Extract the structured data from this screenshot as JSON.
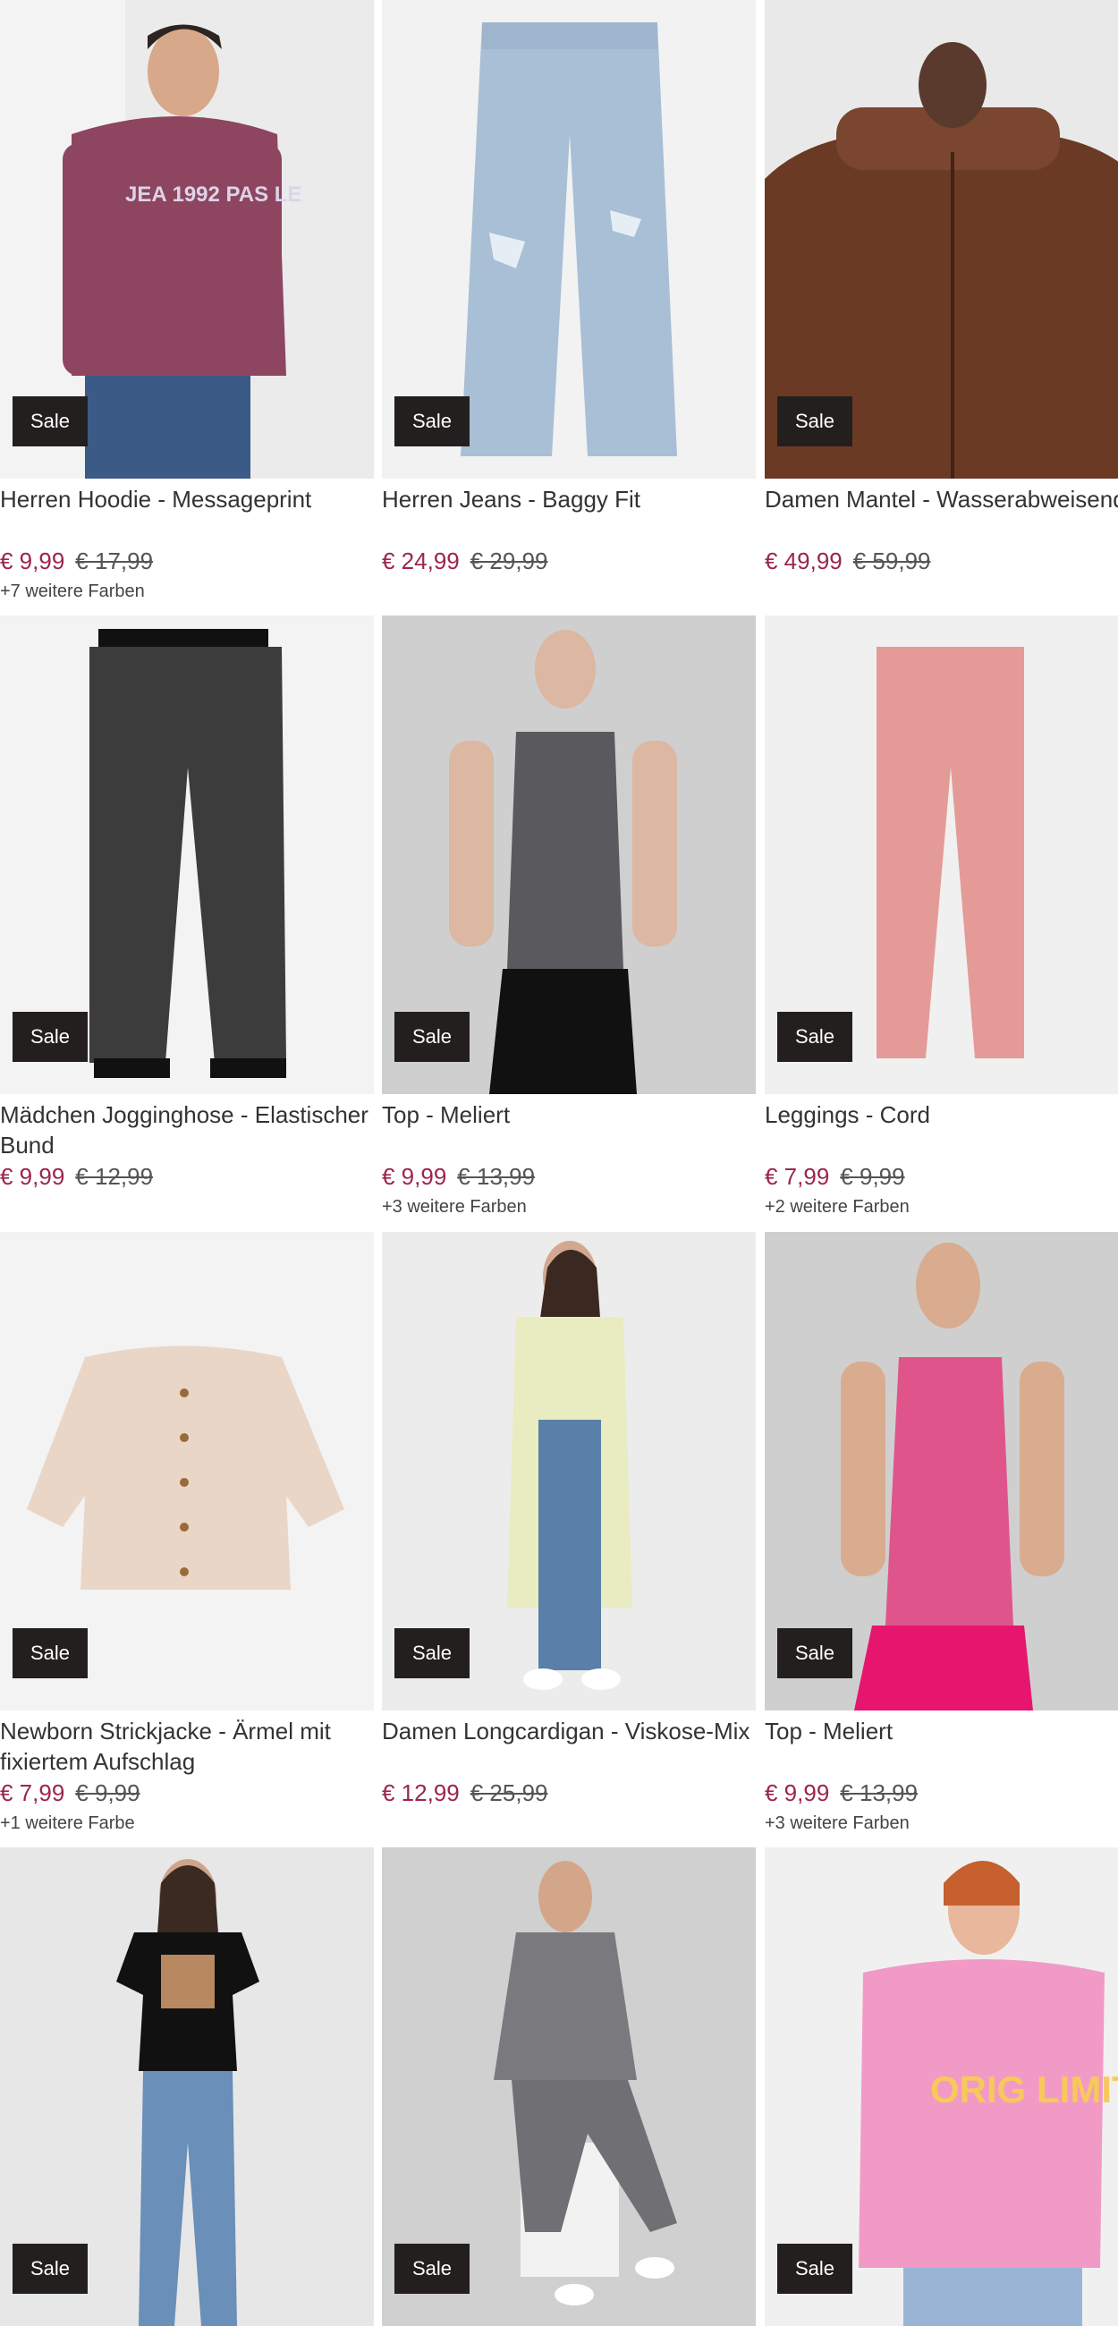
{
  "products": [
    {
      "title": "Herren Hoodie - Messageprint",
      "price": "€ 9,99",
      "old_price": "€ 17,99",
      "colors": "+7 weitere Farben",
      "badge": "Sale",
      "print": "JEA 1992 PAS LE"
    },
    {
      "title": "Herren Jeans - Baggy Fit",
      "price": "€ 24,99",
      "old_price": "€ 29,99",
      "colors": "",
      "badge": "Sale"
    },
    {
      "title": "Damen Mantel - Wasserabweisend",
      "price": "€ 49,99",
      "old_price": "€ 59,99",
      "colors": "",
      "badge": "Sale"
    },
    {
      "title": "Mädchen Jogginghose - Elastischer Bund",
      "price": "€ 9,99",
      "old_price": "€ 12,99",
      "colors": "",
      "badge": "Sale"
    },
    {
      "title": "Top - Meliert",
      "price": "€ 9,99",
      "old_price": "€ 13,99",
      "colors": "+3 weitere Farben",
      "badge": "Sale"
    },
    {
      "title": "Leggings - Cord",
      "price": "€ 7,99",
      "old_price": "€ 9,99",
      "colors": "+2 weitere Farben",
      "badge": "Sale"
    },
    {
      "title": "Newborn Strickjacke - Ärmel mit fixiertem Aufschlag",
      "price": "€ 7,99",
      "old_price": "€ 9,99",
      "colors": "+1 weitere Farbe",
      "badge": "Sale"
    },
    {
      "title": "Damen Longcardigan - Viskose-Mix",
      "price": "€ 12,99",
      "old_price": "€ 25,99",
      "colors": "",
      "badge": "Sale"
    },
    {
      "title": "Top - Meliert",
      "price": "€ 9,99",
      "old_price": "€ 13,99",
      "colors": "+3 weitere Farben",
      "badge": "Sale"
    },
    {
      "title": "",
      "price": "",
      "old_price": "",
      "colors": "",
      "badge": "Sale"
    },
    {
      "title": "",
      "price": "",
      "old_price": "",
      "colors": "",
      "badge": "Sale"
    },
    {
      "title": "",
      "price": "",
      "old_price": "",
      "colors": "",
      "badge": "Sale",
      "print": "ORIG LIMIT"
    }
  ],
  "colors": {
    "price": "#9c2450",
    "badge_bg": "#231f1e",
    "badge_text": "#ffffff"
  }
}
